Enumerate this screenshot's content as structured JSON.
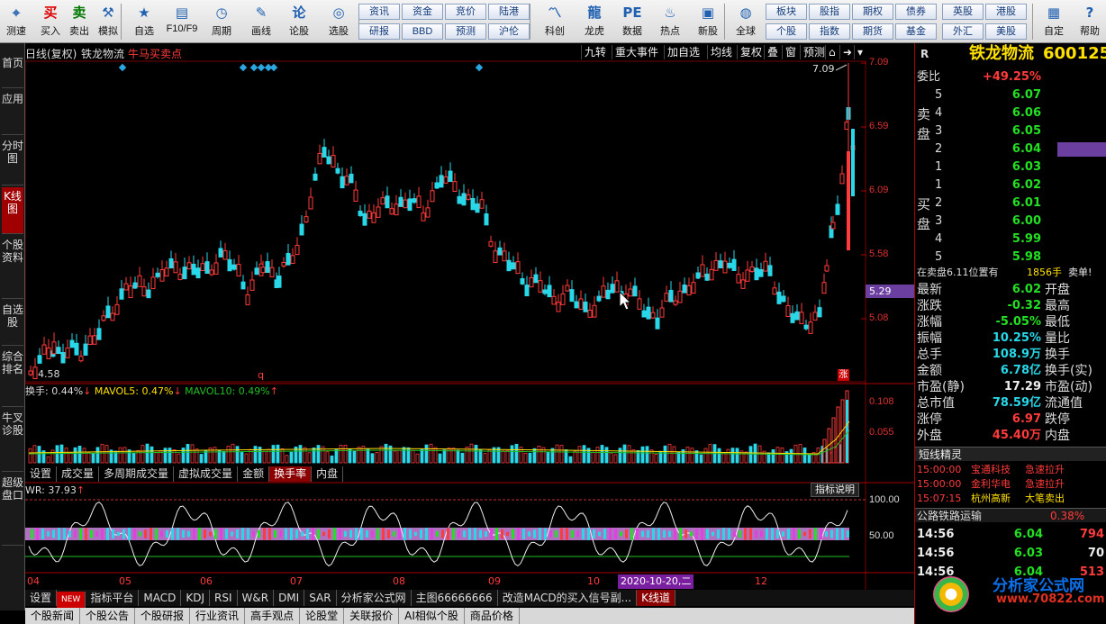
{
  "toolbar": {
    "items": [
      {
        "label": "测速",
        "icon": "speed-icon",
        "glyph": "⌖"
      },
      {
        "label": "买入",
        "icon": "buy-icon",
        "glyph": "买"
      },
      {
        "label": "卖出",
        "icon": "sell-icon",
        "glyph": "卖"
      },
      {
        "label": "模拟",
        "icon": "hammer-icon",
        "glyph": "⚒"
      },
      {
        "label": "自选",
        "icon": "star-icon",
        "glyph": "★"
      },
      {
        "label": "F10/F9",
        "icon": "f10-icon",
        "glyph": "▤"
      },
      {
        "label": "周期",
        "icon": "clock-icon",
        "glyph": "◷"
      },
      {
        "label": "画线",
        "icon": "pencil-icon",
        "glyph": "✎"
      },
      {
        "label": "论股",
        "icon": "discuss-icon",
        "glyph": "论"
      },
      {
        "label": "选股",
        "icon": "select-icon",
        "glyph": "◎"
      },
      {
        "label": "科创",
        "icon": "chart-icon",
        "glyph": "〽"
      },
      {
        "label": "龙虎",
        "icon": "dragon-icon",
        "glyph": "龍"
      },
      {
        "label": "数据",
        "icon": "pe-icon",
        "glyph": "PE"
      },
      {
        "label": "热点",
        "icon": "fire-icon",
        "glyph": "♨"
      },
      {
        "label": "新股",
        "icon": "new-icon",
        "glyph": "▣"
      },
      {
        "label": "全球",
        "icon": "globe-icon",
        "glyph": "◍"
      },
      {
        "label": "自定",
        "icon": "custom-icon",
        "glyph": "▦"
      },
      {
        "label": "帮助",
        "icon": "help-icon",
        "glyph": "?"
      }
    ],
    "grid_buttons": [
      "资讯",
      "资金",
      "竞价",
      "陆港",
      "研报",
      "BBD",
      "预测",
      "沪伦",
      "板块",
      "股指",
      "期权",
      "债券",
      "英股",
      "港股",
      "个股",
      "指数",
      "期货",
      "基金",
      "外汇",
      "美股"
    ]
  },
  "left_tabs": [
    "首页",
    "应用",
    "分时图",
    "K线图",
    "个股资料",
    "自选股",
    "综合排名",
    "牛叉诊股",
    "超级盘口"
  ],
  "chart": {
    "header": {
      "mode": "日线(复权)",
      "name": "铁龙物流",
      "indicator": "牛马买卖点"
    },
    "tools": [
      "九转",
      "重大事件",
      "加自选",
      "均线",
      "复权",
      "叠",
      "窗",
      "预测"
    ],
    "price_labels": [
      "7.09",
      "6.59",
      "6.09",
      "5.58",
      "5.08"
    ],
    "current_price": "5.29",
    "high_mark": "7.09",
    "low_mark": "4.58",
    "marker_q": "q",
    "marker_up": "涨",
    "vol": {
      "a": "换手: 0.44%",
      "b": "MAVOL5: 0.47%",
      "c": "MAVOL10: 0.49%",
      "labels": [
        "0.108",
        "0.055"
      ]
    },
    "subtabs": [
      "设置",
      "成交量",
      "多周期成交量",
      "虚拟成交量",
      "金额",
      "换手率",
      "内盘"
    ],
    "wr": {
      "title": "WR: 37.93",
      "btn": "指标说明",
      "labels": [
        "100.00",
        "50.00"
      ]
    },
    "x_labels": [
      "04",
      "05",
      "06",
      "07",
      "08",
      "09",
      "10",
      "12"
    ],
    "x_highlight": "2020-10-20,二"
  },
  "bottom_tabs": [
    "设置",
    "NEW",
    "指标平台",
    "MACD",
    "KDJ",
    "RSI",
    "W&R",
    "DMI",
    "SAR",
    "分析家公式网",
    "主图66666666",
    "改造MACD的买入信号副...",
    "K线道"
  ],
  "bottom_tabs2": [
    "个股新闻",
    "个股公告",
    "个股研报",
    "行业资讯",
    "高手观点",
    "论股堂",
    "关联报价",
    "AI相似个股",
    "商品价格"
  ],
  "quote": {
    "letter": "R",
    "title": "铁龙物流",
    "code": "600125",
    "weibi_label": "委比",
    "weibi": "+49.25%",
    "sell_label": "卖盘",
    "buy_label": "买盘",
    "sell": [
      [
        "5",
        "6.07"
      ],
      [
        "4",
        "6.06"
      ],
      [
        "3",
        "6.05"
      ],
      [
        "2",
        "6.04"
      ],
      [
        "1",
        "6.03"
      ]
    ],
    "buy": [
      [
        "1",
        "6.02"
      ],
      [
        "2",
        "6.01"
      ],
      [
        "3",
        "6.00"
      ],
      [
        "4",
        "5.99"
      ],
      [
        "5",
        "5.98"
      ]
    ],
    "notice": {
      "a": "在卖盘6.11位置有",
      "b": "1856手",
      "c": "卖单!"
    },
    "stats": [
      [
        "最新",
        "6.02",
        "开盘"
      ],
      [
        "涨跌",
        "-0.32",
        "最高"
      ],
      [
        "涨幅",
        "-5.05%",
        "最低"
      ],
      [
        "振幅",
        "10.25%",
        "量比"
      ],
      [
        "总手",
        "108.9万",
        "换手"
      ],
      [
        "金额",
        "6.78亿",
        "换手(实)"
      ],
      [
        "市盈(静)",
        "17.29",
        "市盈(动)"
      ],
      [
        "总市值",
        "78.59亿",
        "流通值"
      ],
      [
        "涨停",
        "6.97",
        "跌停"
      ],
      [
        "外盘",
        "45.40万",
        "内盘"
      ]
    ],
    "sprite_title": "短线精灵",
    "sprites": [
      [
        "15:00:00",
        "宝通科技",
        "急速拉升"
      ],
      [
        "15:00:00",
        "金利华电",
        "急速拉升"
      ],
      [
        "15:07:15",
        "杭州高新",
        "大笔卖出"
      ]
    ],
    "sector": {
      "name": "公路铁路运输",
      "pct": "0.38%"
    },
    "ticks": [
      [
        "14:56",
        "6.04",
        "794"
      ],
      [
        "14:56",
        "6.03",
        "70"
      ],
      [
        "14:56",
        "6.04",
        "513"
      ]
    ]
  },
  "watermark": "分析家公式网",
  "watermark_url": "www.70822.com"
}
